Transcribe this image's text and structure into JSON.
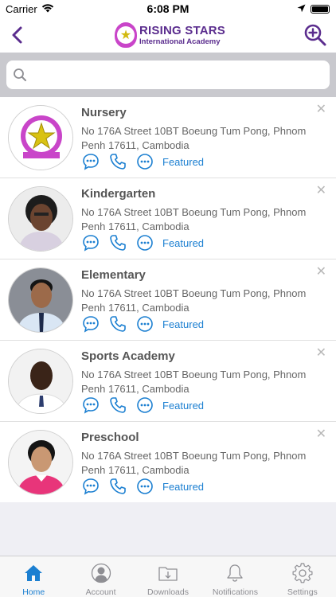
{
  "status_bar": {
    "carrier": "Carrier",
    "time": "6:08 PM"
  },
  "header": {
    "logo_title": "RISING STARS",
    "logo_subtitle": "International Academy",
    "brand_color": "#5b2d8e"
  },
  "search": {
    "value": "",
    "placeholder": ""
  },
  "list": {
    "items": [
      {
        "title": "Nursery",
        "address": "No 176A Street 10BT Boeung Tum Pong, Phnom Penh 17611, Cambodia",
        "badge": "Featured",
        "avatar": "logo"
      },
      {
        "title": "Kindergarten",
        "address": "No 176A Street 10BT Boeung Tum Pong, Phnom Penh 17611, Cambodia",
        "badge": "Featured",
        "avatar": "person"
      },
      {
        "title": "Elementary",
        "address": "No 176A Street 10BT Boeung Tum Pong, Phnom Penh 17611, Cambodia",
        "badge": "Featured",
        "avatar": "person"
      },
      {
        "title": "Sports Academy",
        "address": "No 176A Street 10BT Boeung Tum Pong, Phnom Penh 17611, Cambodia",
        "badge": "Featured",
        "avatar": "person"
      },
      {
        "title": "Preschool",
        "address": "No 176A Street 10BT Boeung Tum Pong, Phnom Penh 17611, Cambodia",
        "badge": "Featured",
        "avatar": "person"
      }
    ]
  },
  "tabs": [
    {
      "label": "Home",
      "icon": "home-icon",
      "active": true
    },
    {
      "label": "Account",
      "icon": "account-icon",
      "active": false
    },
    {
      "label": "Downloads",
      "icon": "downloads-icon",
      "active": false
    },
    {
      "label": "Notifications",
      "icon": "bell-icon",
      "active": false
    },
    {
      "label": "Settings",
      "icon": "gear-icon",
      "active": false
    }
  ],
  "colors": {
    "accent": "#1b7fd1",
    "nav_purple": "#5b2d8e"
  }
}
